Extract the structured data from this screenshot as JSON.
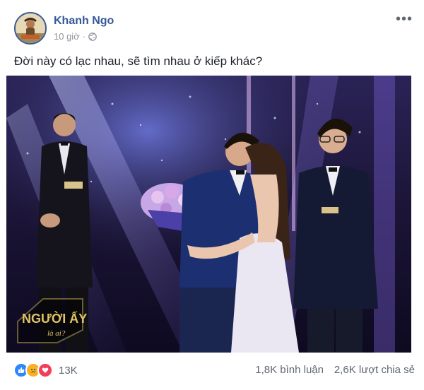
{
  "post": {
    "author": "Khanh Ngo",
    "time": "10 giờ",
    "time_separator": "·",
    "privacy_icon": "globe-icon",
    "more_icon": "more-icon",
    "text": "Đời này có lạc nhau, sẽ tìm nhau ở kiếp khác?"
  },
  "photo": {
    "logo_main": "NGƯỜI ẤY",
    "logo_sub": "là ai?",
    "colors": {
      "stage_bg": "#1b1436",
      "light_beam": "#9aa6ff",
      "accent": "#d4bb5a"
    }
  },
  "footer": {
    "reactions": [
      {
        "name": "like",
        "color": "#2d88ff"
      },
      {
        "name": "sad",
        "color": "#f7b125"
      },
      {
        "name": "love",
        "color": "#f33e58"
      }
    ],
    "reaction_count": "13K",
    "comments": "1,8K bình luận",
    "shares": "2,6K lượt chia sẻ"
  }
}
